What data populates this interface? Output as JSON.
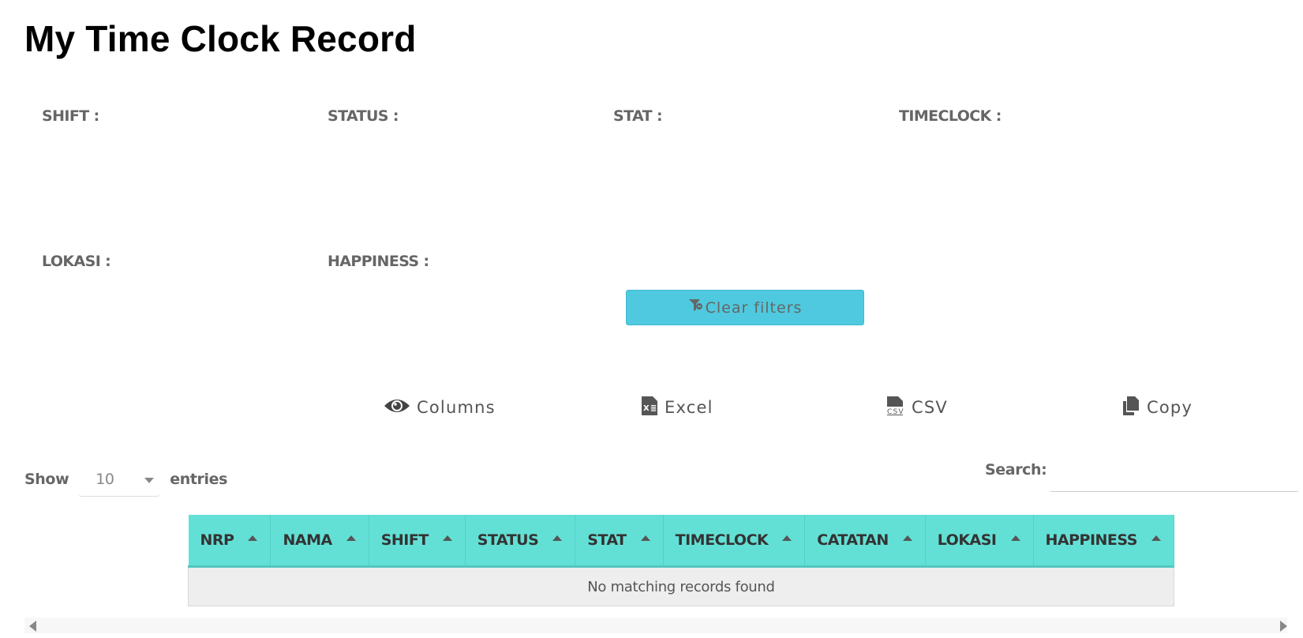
{
  "page": {
    "title": "My Time Clock Record"
  },
  "filters": {
    "shift_label": "SHIFT :",
    "status_label": "STATUS :",
    "stat_label": "STAT :",
    "timeclock_label": "TIMECLOCK :",
    "lokasi_label": "LOKASI :",
    "happiness_label": "HAPPINESS :",
    "clear_label": "Clear filters"
  },
  "toolbar": {
    "columns_label": "Columns",
    "excel_label": "Excel",
    "csv_label": "CSV",
    "copy_label": "Copy"
  },
  "length_menu": {
    "show_label": "Show",
    "value": "10",
    "entries_label": "entries"
  },
  "search": {
    "label": "Search:",
    "value": ""
  },
  "table": {
    "columns": [
      "NRP",
      "NAMA",
      "SHIFT",
      "STATUS",
      "STAT",
      "TIMECLOCK",
      "CATATAN",
      "LOKASI",
      "HAPPINESS"
    ],
    "empty_message": "No matching records found"
  },
  "colors": {
    "header_bg": "#63e0d6",
    "button_bg": "#4ec9df"
  },
  "icons": {
    "columns": "eye-icon",
    "excel": "excel-file-icon",
    "csv": "csv-file-icon",
    "copy": "copy-icon",
    "clear": "filter-clear-icon"
  }
}
